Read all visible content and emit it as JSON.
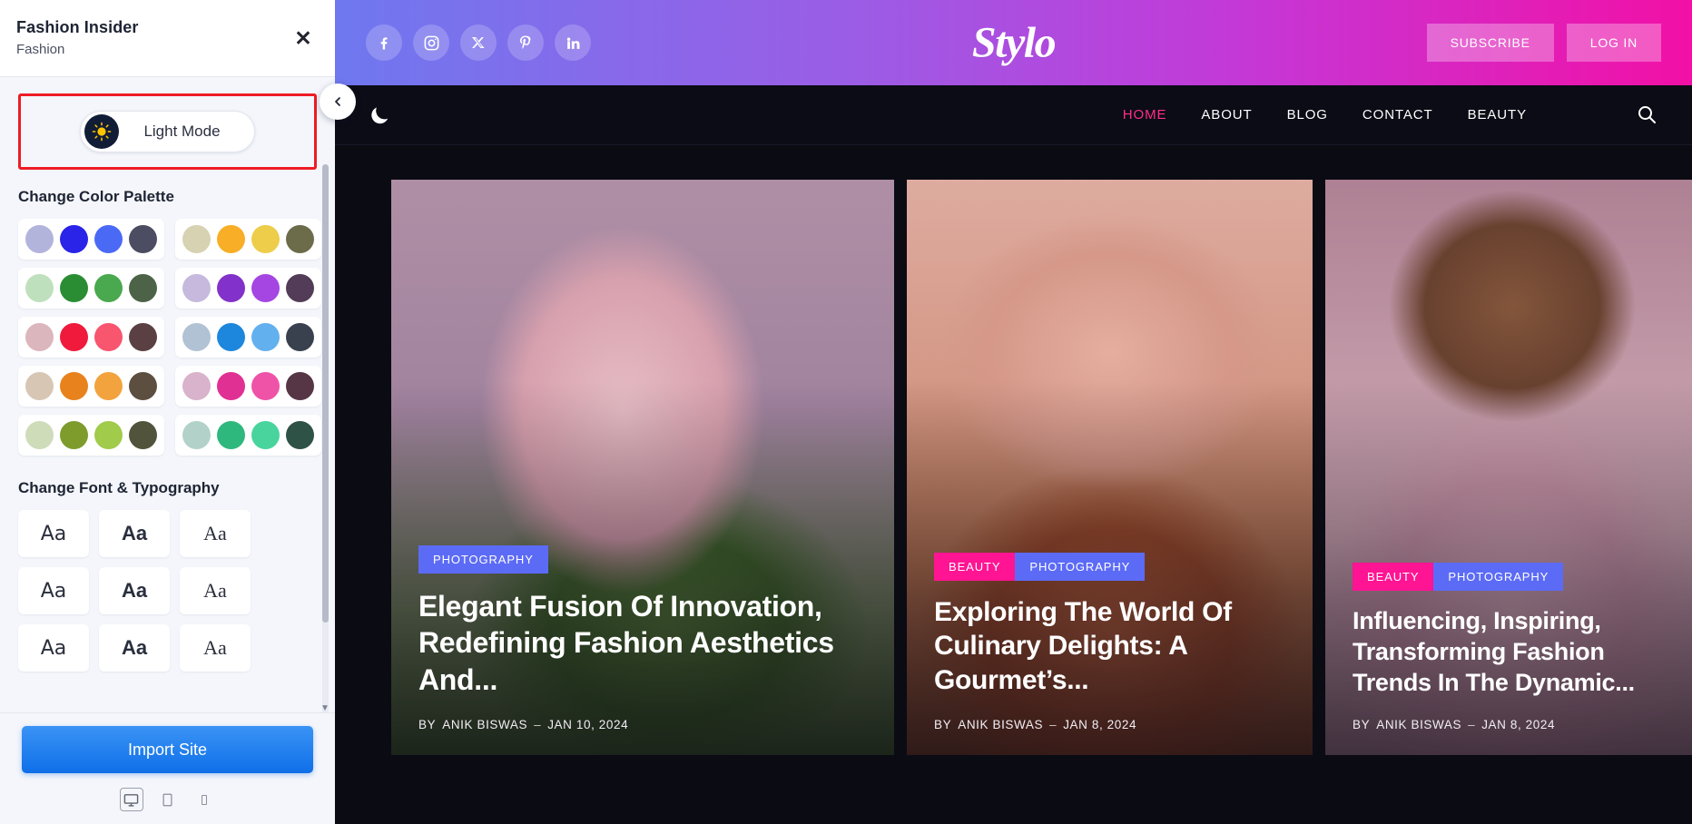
{
  "panel": {
    "title": "Fashion Insider",
    "subtitle": "Fashion",
    "close_icon": "close-icon",
    "mode_toggle": {
      "label": "Light Mode",
      "icon": "sun-icon",
      "highlight_color": "#ee1c25"
    },
    "palette_section_title": "Change Color Palette",
    "palettes": [
      {
        "name": "periwinkle-blue",
        "colors": [
          "#b3b4dc",
          "#2a23e8",
          "#4a6af6",
          "#4c4d63"
        ]
      },
      {
        "name": "sand-amber",
        "colors": [
          "#d6d2b2",
          "#f8ae26",
          "#edcd4a",
          "#6c6c4a"
        ]
      },
      {
        "name": "mint-green",
        "colors": [
          "#bfe0bc",
          "#2a8d33",
          "#4aa84f",
          "#4c6348"
        ]
      },
      {
        "name": "lilac-purple",
        "colors": [
          "#c6b9dd",
          "#8232ca",
          "#a546e2",
          "#533c58"
        ]
      },
      {
        "name": "blush-red",
        "colors": [
          "#dcb6bd",
          "#ef1a3c",
          "#f8556f",
          "#5b4043"
        ]
      },
      {
        "name": "sky-blue",
        "colors": [
          "#b0c2d4",
          "#1d87dd",
          "#63b0ef",
          "#3a414e"
        ]
      },
      {
        "name": "beige-orange",
        "colors": [
          "#d8c6b4",
          "#e8821d",
          "#f2a33e",
          "#5c4f3f"
        ]
      },
      {
        "name": "pink-magenta",
        "colors": [
          "#d9b2cb",
          "#e03094",
          "#ee53a8",
          "#563545"
        ]
      },
      {
        "name": "olive-lime",
        "colors": [
          "#cfdcb9",
          "#7d9c2c",
          "#a0cb4b",
          "#51543a"
        ]
      },
      {
        "name": "teal-emerald",
        "colors": [
          "#b2d2c9",
          "#2fb87e",
          "#49d49d",
          "#2f5247"
        ]
      }
    ],
    "typography_section_title": "Change Font & Typography",
    "typography_samples": [
      {
        "sample": "Aa",
        "style": "sans"
      },
      {
        "sample": "Aa",
        "style": "bold"
      },
      {
        "sample": "Aa",
        "style": "serif"
      },
      {
        "sample": "Aa",
        "style": "sans"
      },
      {
        "sample": "Aa",
        "style": "bold"
      },
      {
        "sample": "Aa",
        "style": "serif"
      },
      {
        "sample": "Aa",
        "style": "sans"
      },
      {
        "sample": "Aa",
        "style": "bold"
      },
      {
        "sample": "Aa",
        "style": "serif"
      }
    ],
    "import_button": "Import Site",
    "devices": [
      {
        "name": "desktop",
        "icon": "desktop-icon",
        "active": true
      },
      {
        "name": "tablet",
        "icon": "tablet-icon",
        "active": false
      },
      {
        "name": "mobile",
        "icon": "mobile-icon",
        "active": false
      }
    ],
    "collapse_icon": "chevron-left-icon"
  },
  "preview": {
    "topbar": {
      "brand": "Stylo",
      "socials": [
        "facebook-icon",
        "instagram-icon",
        "twitter-x-icon",
        "pinterest-icon",
        "linkedin-icon"
      ],
      "subscribe_label": "SUBSCRIBE",
      "login_label": "LOG IN",
      "gradient_start": "#6f78ef",
      "gradient_end": "#f210a6"
    },
    "navbar": {
      "mode_icon": "moon-icon",
      "links": [
        "HOME",
        "ABOUT",
        "BLOG",
        "CONTACT",
        "BEAUTY"
      ],
      "active_link": "HOME",
      "active_color": "#ff2d8a",
      "search_icon": "search-icon"
    },
    "cards": [
      {
        "tags": [
          {
            "label": "PHOTOGRAPHY",
            "color": "#5c6bf5"
          }
        ],
        "title": "Elegant Fusion Of Innovation, Redefining Fashion Aesthetics And...",
        "by_label": "BY",
        "author": "ANIK BISWAS",
        "separator": "–",
        "date": "JAN 10, 2024"
      },
      {
        "tags": [
          {
            "label": "BEAUTY",
            "color": "#ff1493"
          },
          {
            "label": "PHOTOGRAPHY",
            "color": "#5c6bf5"
          }
        ],
        "title": "Exploring The World Of Culinary Delights: A Gourmet’s...",
        "by_label": "BY",
        "author": "ANIK BISWAS",
        "separator": "–",
        "date": "JAN 8, 2024"
      },
      {
        "tags": [
          {
            "label": "BEAUTY",
            "color": "#ff1493"
          },
          {
            "label": "PHOTOGRAPHY",
            "color": "#5c6bf5"
          }
        ],
        "title": "Influencing, Inspiring, Transforming Fashion Trends In The Dynamic...",
        "by_label": "BY",
        "author": "ANIK BISWAS",
        "separator": "–",
        "date": "JAN 8, 2024"
      }
    ]
  }
}
